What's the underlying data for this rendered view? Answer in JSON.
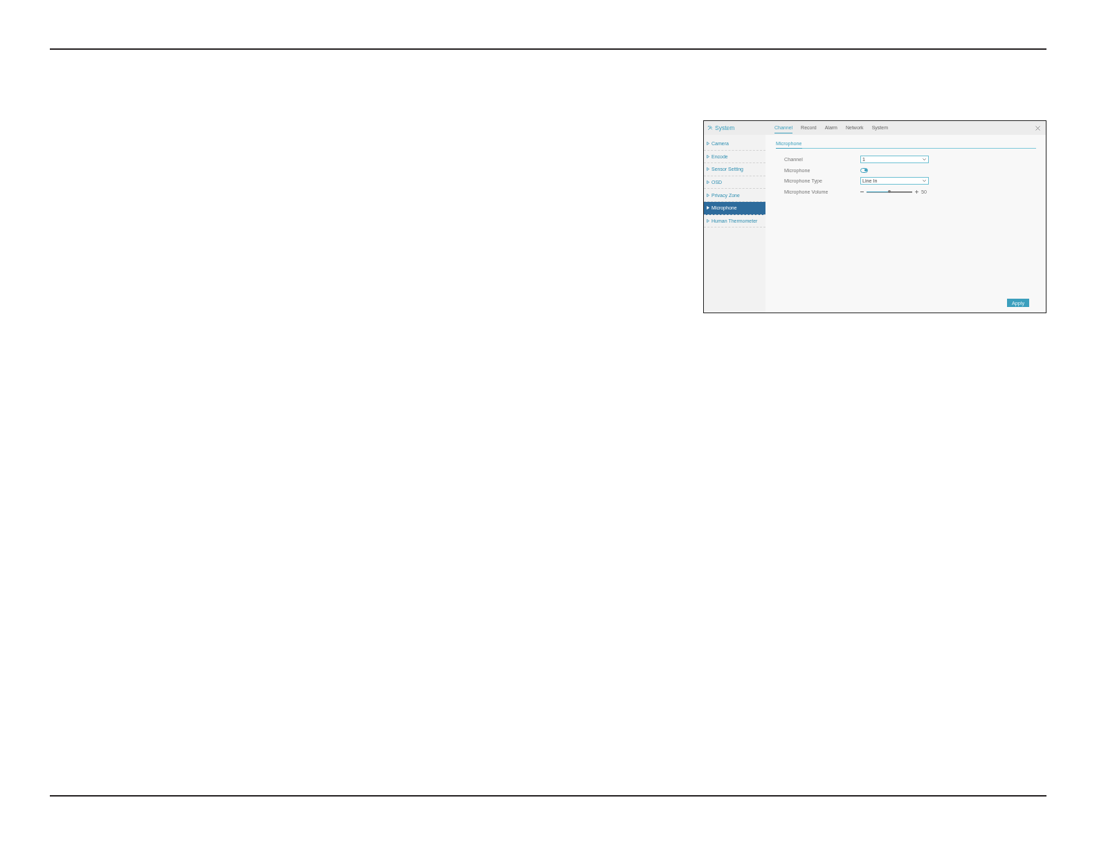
{
  "window": {
    "title": "System",
    "tabs": [
      {
        "label": "Channel",
        "selected": true
      },
      {
        "label": "Record",
        "selected": false
      },
      {
        "label": "Alarm",
        "selected": false
      },
      {
        "label": "Network",
        "selected": false
      },
      {
        "label": "System",
        "selected": false
      }
    ]
  },
  "sidebar": {
    "items": [
      {
        "label": "Camera",
        "selected": false
      },
      {
        "label": "Encode",
        "selected": false
      },
      {
        "label": "Sensor Setting",
        "selected": false
      },
      {
        "label": "OSD",
        "selected": false
      },
      {
        "label": "Privacy Zone",
        "selected": false
      },
      {
        "label": "Microphone",
        "selected": true
      },
      {
        "label": "Human Thermometer",
        "selected": false
      }
    ]
  },
  "section": {
    "title": "Microphone",
    "rows": [
      {
        "kind": "select",
        "label": "Channel",
        "value": "1"
      },
      {
        "kind": "toggle",
        "label": "Microphone",
        "on": true
      },
      {
        "kind": "select",
        "label": "Microphone Type",
        "value": "Line In"
      },
      {
        "kind": "slider",
        "label": "Microphone Volume",
        "level": 0.5,
        "reading": "50"
      }
    ]
  },
  "apply_button": {
    "label": "Apply"
  }
}
